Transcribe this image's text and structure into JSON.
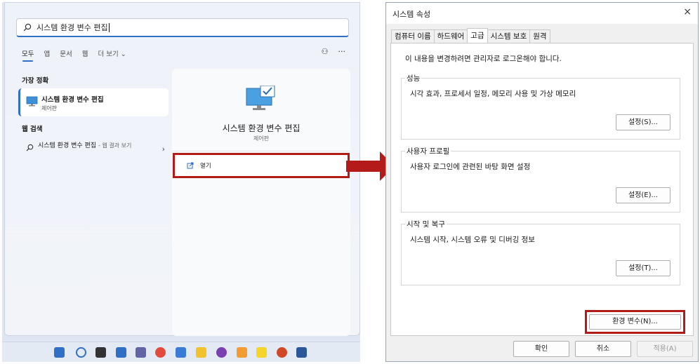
{
  "search": {
    "query": "시스템 환경 변수 편집",
    "filters": [
      "모두",
      "앱",
      "문서",
      "웹",
      "더 보기"
    ],
    "best_match_heading": "가장 정확",
    "best_match": {
      "title": "시스템 환경 변수 편집",
      "subtitle": "제어판"
    },
    "web_heading": "웹 검색",
    "web_result": {
      "title": "시스템 환경 변수 편집",
      "suffix": "- 웹 결과 보기"
    },
    "preview": {
      "title": "시스템 환경 변수 편집",
      "subtitle": "제어판",
      "open_label": "열기"
    },
    "highlight_color": "#b31b1b",
    "accent_color": "#2f6fc6"
  },
  "dialog": {
    "title": "시스템 속성",
    "close_label": "×",
    "tabs": [
      "컴퓨터 이름",
      "하드웨어",
      "고급",
      "시스템 보호",
      "원격"
    ],
    "active_tab": "고급",
    "notice": "이 내용을 변경하려면 관리자로 로그온해야 합니다.",
    "groups": [
      {
        "label": "성능",
        "description": "시각 효과, 프로세서 일정, 메모리 사용 및 가상 메모리",
        "button": "설정(S)..."
      },
      {
        "label": "사용자 프로필",
        "description": "사용자 로그인에 관련된 바탕 화면 설정",
        "button": "설정(E)..."
      },
      {
        "label": "시작 및 복구",
        "description": "시스템 시작, 시스템 오류 및 디버깅 정보",
        "button": "설정(T)..."
      }
    ],
    "env_button": "환경 변수(N)...",
    "footer": {
      "ok": "확인",
      "cancel": "취소",
      "apply": "적용(A)"
    }
  }
}
